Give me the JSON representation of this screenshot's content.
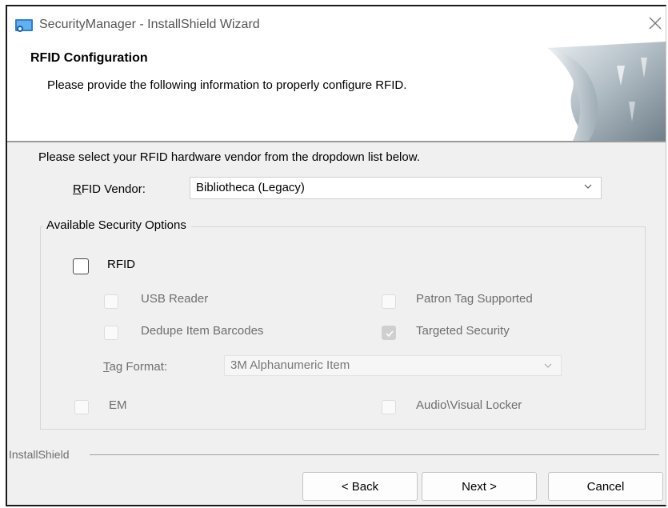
{
  "window": {
    "title": "SecurityManager - InstallShield Wizard",
    "icons": {
      "app": "app-icon",
      "close": "close-icon"
    }
  },
  "header": {
    "title": "RFID Configuration",
    "subtitle": "Please provide the following information to properly configure RFID."
  },
  "main": {
    "intro": "Please select your RFID hardware vendor from the dropdown list below.",
    "vendor": {
      "label_mnemonic": "R",
      "label_rest": "FID Vendor:",
      "selected": "Bibliotheca (Legacy)"
    },
    "security_options": {
      "legend": "Available Security Options",
      "rfid": {
        "label": "RFID",
        "checked": false,
        "enabled": true
      },
      "usb_reader": {
        "label": "USB Reader",
        "checked": false,
        "enabled": false
      },
      "patron_tag_supported": {
        "label": "Patron Tag Supported",
        "checked": false,
        "enabled": false
      },
      "dedupe_item_barcodes": {
        "label": "Dedupe Item Barcodes",
        "checked": false,
        "enabled": false
      },
      "targeted_security": {
        "label": "Targeted Security",
        "checked": true,
        "enabled": false
      },
      "tag_format": {
        "label_mnemonic": "T",
        "label_rest": "ag Format:",
        "selected": "3M Alphanumeric Item"
      },
      "em": {
        "label": "EM",
        "checked": false,
        "enabled": false
      },
      "audio_visual_locker": {
        "label": "Audio\\Visual Locker",
        "checked": false,
        "enabled": false
      }
    }
  },
  "footer": {
    "brand": "InstallShield",
    "back": "< Back",
    "next": "Next >",
    "cancel": "Cancel"
  },
  "colors": {
    "background": "#f0f0f0",
    "header_background": "#ffffff",
    "disabled_text": "#6e6e6e"
  }
}
